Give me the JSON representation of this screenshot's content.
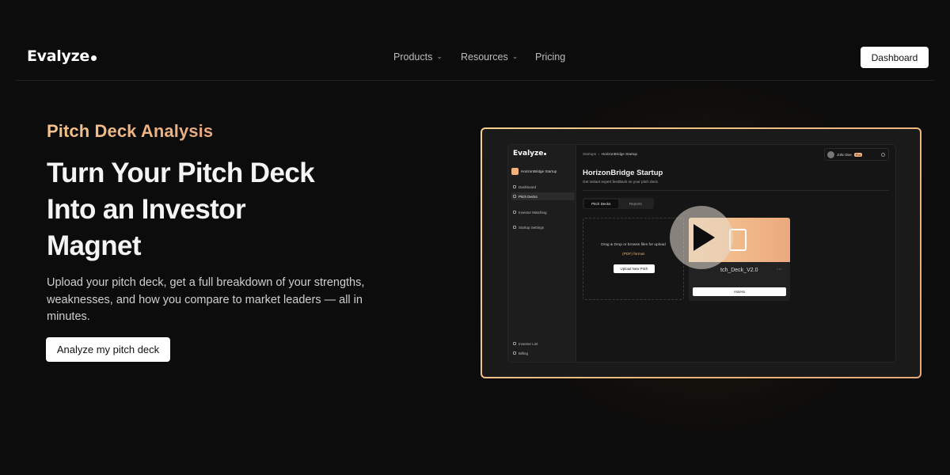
{
  "nav": {
    "logo": "Evalyze",
    "links": [
      {
        "label": "Products",
        "has_dropdown": true
      },
      {
        "label": "Resources",
        "has_dropdown": true
      },
      {
        "label": "Pricing",
        "has_dropdown": false
      }
    ],
    "dashboard_button": "Dashboard"
  },
  "hero": {
    "eyebrow": "Pitch Deck Analysis",
    "headline_lines": [
      "Turn Your Pitch Deck",
      "Into an Investor",
      "Magnet"
    ],
    "subcopy": "Upload your pitch deck, get a full breakdown of your strengths, weaknesses, and how you compare to market leaders — all in minutes.",
    "cta": "Analyze my pitch deck"
  },
  "preview": {
    "app_logo": "Evalyze",
    "org_name": "HorizonBridge Startup",
    "sidebar": {
      "dashboard": "Dashboard",
      "pitch_decks": "Pitch Decks",
      "investor_matching": "Investor Matching",
      "startup_settings": "Startup Settings",
      "investor_list": "Investor List",
      "billing": "Billing"
    },
    "breadcrumb": {
      "root": "Startups",
      "current": "HorizonBridge Startup"
    },
    "user": {
      "name": "John Doe",
      "badge": "Pro"
    },
    "title": "HorizonBridge Startup",
    "subtitle": "Get instant expert feedback on your pitch deck.",
    "tabs": [
      "Pitch Decks",
      "Reports"
    ],
    "dropzone": {
      "text": "Drag & Drop or browse files for upload",
      "format": "(PDF) format",
      "button": "Upload New Pitch"
    },
    "card": {
      "file_name": "tch_Deck_V2.0",
      "more": "···",
      "button": "Assess"
    }
  },
  "colors": {
    "accent_gradient_start": "#f5c48c",
    "accent_gradient_end": "#e8a97e",
    "background": "#0c0c0c"
  }
}
